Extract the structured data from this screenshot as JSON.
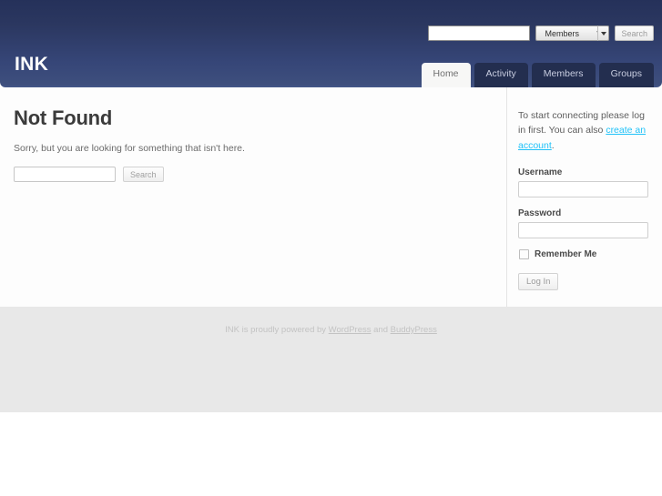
{
  "site": {
    "title": "INK"
  },
  "header_search": {
    "input_value": "",
    "input_placeholder": "",
    "scope_selected": "Members",
    "scope_options": [
      "Members"
    ],
    "submit_label": "Search",
    "dropdown_icon": "chevron-down-icon"
  },
  "nav": {
    "items": [
      {
        "label": "Home",
        "active": true
      },
      {
        "label": "Activity",
        "active": false
      },
      {
        "label": "Members",
        "active": false
      },
      {
        "label": "Groups",
        "active": false
      }
    ]
  },
  "main": {
    "title": "Not Found",
    "message": "Sorry, but you are looking for something that isn't here.",
    "search": {
      "input_value": "",
      "input_placeholder": "",
      "submit_label": "Search"
    }
  },
  "sidebar": {
    "intro_prefix": "To start connecting please log in first. You can also ",
    "intro_link": "create an account",
    "intro_suffix": ".",
    "username_label": "Username",
    "username_value": "",
    "password_label": "Password",
    "password_value": "",
    "remember_label": "Remember Me",
    "remember_checked": false,
    "login_label": "Log In"
  },
  "footer": {
    "prefix": "INK is proudly powered by ",
    "link1": "WordPress",
    "separator": " and ",
    "link2": "BuddyPress"
  },
  "colors": {
    "header_top": "#25315a",
    "header_bottom": "#45578a",
    "tab_inactive_bg": "#232e4f",
    "tab_active_bg": "#f7f7f6",
    "link_accent": "#21c2f8",
    "footer_bg": "#e8e8e8",
    "footer_text": "#c3c3c3"
  }
}
